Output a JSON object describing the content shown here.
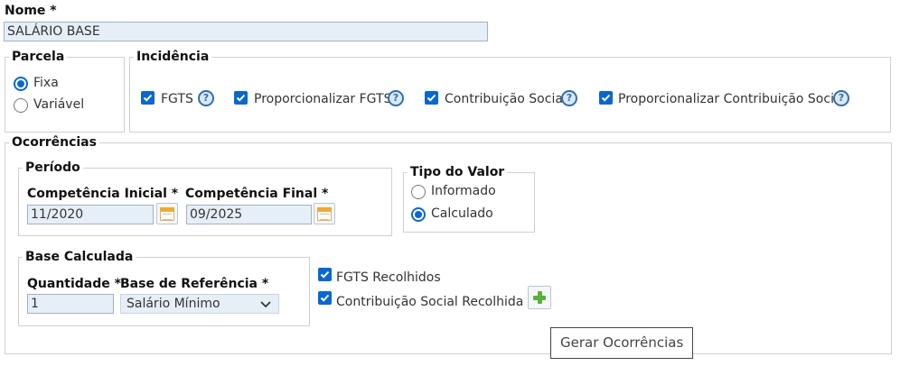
{
  "nome": {
    "label": "Nome *",
    "value": "SALÁRIO BASE"
  },
  "parcela": {
    "legend": "Parcela",
    "options": [
      {
        "label": "Fixa",
        "selected": true
      },
      {
        "label": "Variável",
        "selected": false
      }
    ]
  },
  "incidencia": {
    "legend": "Incidência",
    "items": [
      {
        "label": "FGTS",
        "checked": true
      },
      {
        "label": "Proporcionalizar FGTS",
        "checked": true
      },
      {
        "label": "Contribuição Social",
        "checked": true
      },
      {
        "label": "Proporcionalizar Contribuição Social",
        "checked": true
      }
    ],
    "help_glyph": "?"
  },
  "ocorrencias": {
    "legend": "Ocorrências",
    "periodo": {
      "legend": "Período",
      "competencia_inicial": {
        "label": "Competência Inicial *",
        "value": "11/2020"
      },
      "competencia_final": {
        "label": "Competência Final *",
        "value": "09/2025"
      }
    },
    "tipo_valor": {
      "legend": "Tipo do Valor",
      "options": [
        {
          "label": "Informado",
          "selected": false
        },
        {
          "label": "Calculado",
          "selected": true
        }
      ]
    },
    "base_calculada": {
      "legend": "Base Calculada",
      "quantidade": {
        "label": "Quantidade *",
        "value": "1"
      },
      "base_referencia": {
        "label": "Base de Referência *",
        "value": "Salário Mínimo"
      }
    },
    "recolhidos": [
      {
        "label": "FGTS Recolhidos",
        "checked": true
      },
      {
        "label": "Contribuição Social Recolhida",
        "checked": true
      }
    ],
    "tooltip": "Gerar Ocorrências"
  },
  "colors": {
    "accent": "#0a67d0",
    "field_bg": "#e6eef7",
    "plus": "#57b23a",
    "help": "#2f6fb5"
  }
}
